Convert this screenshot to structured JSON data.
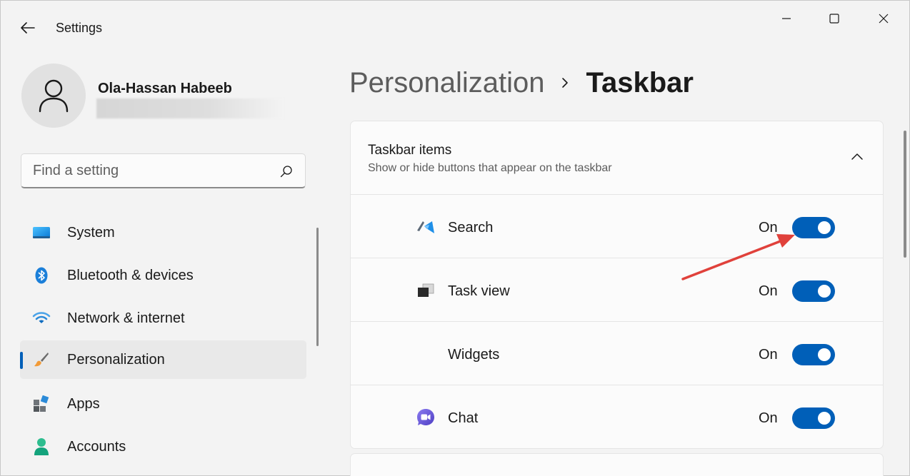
{
  "window": {
    "title": "Settings",
    "controls": [
      "minimize",
      "maximize",
      "close"
    ]
  },
  "profile": {
    "name": "Ola-Hassan Habeeb"
  },
  "search": {
    "placeholder": "Find a setting"
  },
  "sidebar": {
    "selected": "Personalization",
    "items": [
      {
        "label": "System",
        "icon": "system-icon"
      },
      {
        "label": "Bluetooth & devices",
        "icon": "bluetooth-icon"
      },
      {
        "label": "Network & internet",
        "icon": "wifi-icon"
      },
      {
        "label": "Personalization",
        "icon": "brush-icon"
      },
      {
        "label": "Apps",
        "icon": "apps-icon"
      },
      {
        "label": "Accounts",
        "icon": "accounts-icon"
      }
    ]
  },
  "header": {
    "parent": "Personalization",
    "current": "Taskbar"
  },
  "taskbar_items": {
    "title": "Taskbar items",
    "subtitle": "Show or hide buttons that appear on the taskbar",
    "expanded": true,
    "rows": [
      {
        "label": "Search",
        "state": "On",
        "on": true,
        "icon": "search-app-icon"
      },
      {
        "label": "Task view",
        "state": "On",
        "on": true,
        "icon": "task-view-icon"
      },
      {
        "label": "Widgets",
        "state": "On",
        "on": true,
        "icon": "widgets-icon"
      },
      {
        "label": "Chat",
        "state": "On",
        "on": true,
        "icon": "chat-icon"
      }
    ]
  },
  "colors": {
    "accent": "#005fb8",
    "annotation_arrow": "#e0413b"
  }
}
